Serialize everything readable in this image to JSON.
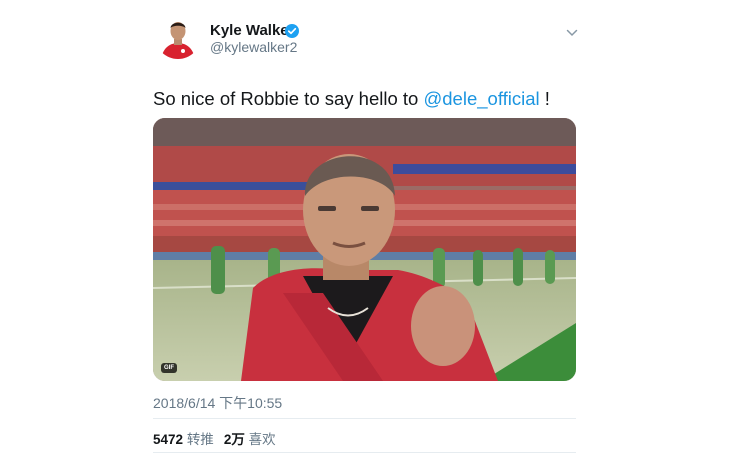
{
  "author": {
    "name": "Kyle Walker",
    "handle": "@kylewalker2"
  },
  "tweet": {
    "text_before": "So nice of Robbie to say hello to ",
    "mention": "@dele_official",
    "text_after": " !"
  },
  "media": {
    "badge": "GIF"
  },
  "timestamp": "2018/6/14 下午10:55",
  "stats": {
    "retweets_value": "5472",
    "retweets_label": "转推",
    "likes_value": "2万",
    "likes_label": "喜欢"
  },
  "colors": {
    "accent": "#1b95e0",
    "secondary_text": "#657786",
    "divider": "#e6ecf0"
  }
}
